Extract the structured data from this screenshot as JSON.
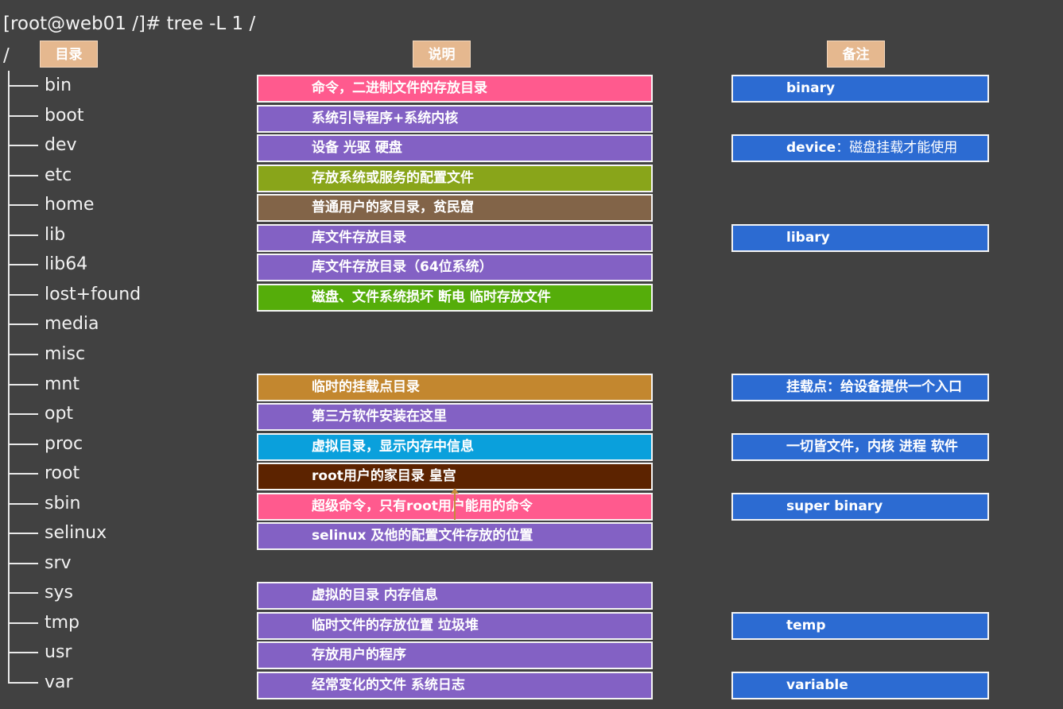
{
  "terminal": {
    "command": "[root@web01 /]# tree -L 1 /",
    "root": "/"
  },
  "headers": {
    "dir": "目录",
    "desc": "说明",
    "note": "备注"
  },
  "rows": [
    {
      "name": "bin",
      "desc": "命令，二进制文件的存放目录",
      "desc_color": "#ff5a8e",
      "note": "binary"
    },
    {
      "name": "boot",
      "desc": "系统引导程序+系统内核",
      "desc_color": "#8361c4"
    },
    {
      "name": "dev",
      "desc": "设备 光驱 硬盘",
      "desc_color": "#8361c4",
      "note": "device",
      "note_sub": "：磁盘挂载才能使用"
    },
    {
      "name": "etc",
      "desc": "存放系统或服务的配置文件",
      "desc_color": "#89a51a"
    },
    {
      "name": "home",
      "desc": "普通用户的家目录，贫民窟",
      "desc_color": "#826448"
    },
    {
      "name": "lib",
      "desc": "库文件存放目录",
      "desc_color": "#8361c4",
      "note": "libary"
    },
    {
      "name": "lib64",
      "desc": "库文件存放目录（64位系统）",
      "desc_color": "#8361c4"
    },
    {
      "name": "lost+found",
      "desc": "磁盘、文件系统损坏 断电 临时存放文件",
      "desc_color": "#55ad0a"
    },
    {
      "name": "media"
    },
    {
      "name": "misc"
    },
    {
      "name": "mnt",
      "desc": "临时的挂载点目录",
      "desc_color": "#c3872f",
      "note": "挂载点：给设备提供一个入口"
    },
    {
      "name": "opt",
      "desc": "第三方软件安装在这里",
      "desc_color": "#8361c4"
    },
    {
      "name": "proc",
      "desc": "虚拟目录，显示内存中信息",
      "desc_color": "#0aa0dc",
      "note": "一切皆文件，内核 进程 软件"
    },
    {
      "name": "root",
      "desc": "root用户的家目录 皇宫",
      "desc_color": "#5c2300"
    },
    {
      "name": "sbin",
      "desc": "超级命令，只有root用户能用的命令",
      "desc_color": "#ff5a8e",
      "note": "super  binary"
    },
    {
      "name": "selinux",
      "desc": "selinux 及他的配置文件存放的位置",
      "desc_color": "#8361c4"
    },
    {
      "name": "srv"
    },
    {
      "name": "sys",
      "desc": "虚拟的目录 内存信息",
      "desc_color": "#8361c4"
    },
    {
      "name": "tmp",
      "desc": "临时文件的存放位置 垃圾堆",
      "desc_color": "#8361c4",
      "note": "temp"
    },
    {
      "name": "usr",
      "desc": "存放用户的程序",
      "desc_color": "#8361c4"
    },
    {
      "name": "var",
      "desc": "经常变化的文件 系统日志",
      "desc_color": "#8361c4",
      "note": "variable"
    }
  ]
}
